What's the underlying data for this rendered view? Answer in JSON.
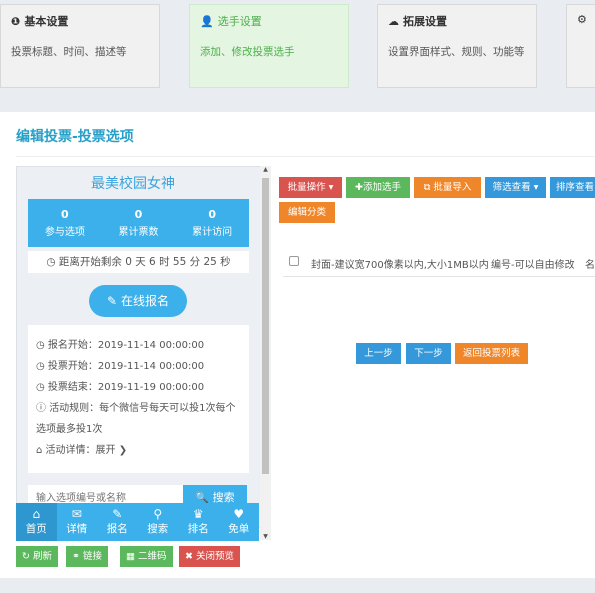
{
  "steps": [
    {
      "icon": "info-icon",
      "title": "基本设置",
      "desc": "投票标题、时间、描述等"
    },
    {
      "icon": "user-plus-icon",
      "title": "选手设置",
      "desc": "添加、修改投票选手"
    },
    {
      "icon": "cloud-icon",
      "title": "拓展设置",
      "desc": "设置界面样式、规则、功能等"
    },
    {
      "icon": "gear-icon",
      "title": "",
      "desc": ""
    }
  ],
  "page_title": "编辑投票-投票选项",
  "preview": {
    "title": "最美校园女神",
    "stats": [
      {
        "value": "0",
        "label": "参与选项"
      },
      {
        "value": "0",
        "label": "累计票数"
      },
      {
        "value": "0",
        "label": "累计访问"
      }
    ],
    "countdown": "距离开始剩余 0 天 6 时 55 分 25 秒",
    "signup_label": "在线报名",
    "info": {
      "signup_start": "报名开始：2019-11-14 00:00:00",
      "vote_start": "投票开始：2019-11-14 00:00:00",
      "vote_end": "投票结束：2019-11-19 00:00:00",
      "rules": "活动规则：每个微信号每天可以投1次每个选项最多投1次",
      "details": "活动详情：展开"
    },
    "search_placeholder": "输入选项编号或名称",
    "search_label": "搜索",
    "tabs": [
      {
        "icon": "home-icon",
        "label": "首页",
        "active": true
      },
      {
        "icon": "gift-icon",
        "label": "详情",
        "active": false
      },
      {
        "icon": "edit-icon",
        "label": "报名",
        "active": false
      },
      {
        "icon": "search-icon",
        "label": "搜索",
        "active": false
      },
      {
        "icon": "trophy-icon",
        "label": "排名",
        "active": false
      },
      {
        "icon": "thumbs-up-icon",
        "label": "免单",
        "active": false
      }
    ]
  },
  "preview_actions": {
    "refresh": "刷新",
    "link": "链接",
    "qrcode": "二维码",
    "close_preview": "关闭预览"
  },
  "toolbar": {
    "batch_ops": "批量操作",
    "add_player": "添加选手",
    "batch_import": "批量导入",
    "filter_view": "筛选查看",
    "sort_view": "排序查看",
    "edit_category": "编辑分类"
  },
  "table": {
    "col_cover": "封面-建议宽700像素以内,大小1MB以内",
    "col_number": "编号-可以自由修改",
    "col_name": "名"
  },
  "pager": {
    "prev": "上一步",
    "next": "下一步",
    "back_to_list": "返回投票列表"
  },
  "colors": {
    "accent": "#3cb0ea",
    "title": "#27a0c9",
    "active_step": "#4cae4c",
    "danger": "#d9534f",
    "success": "#5cb85c",
    "warning": "#f0ad4e"
  }
}
